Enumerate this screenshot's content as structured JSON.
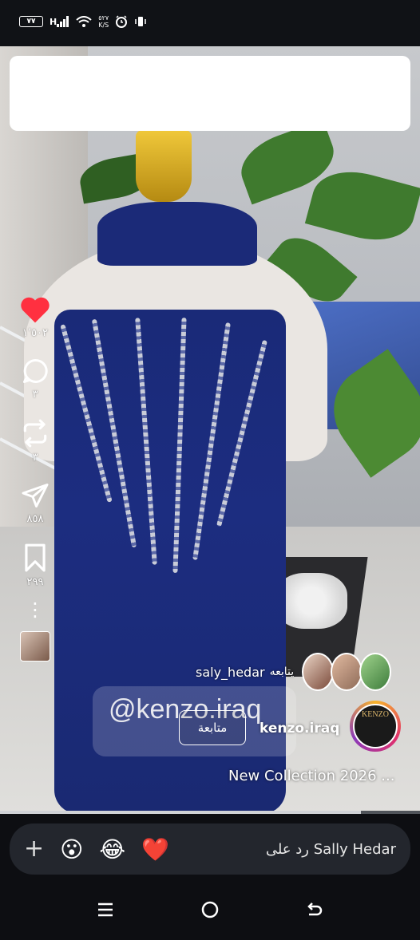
{
  "status_bar": {
    "battery_level": "٧٧",
    "network_type": "H",
    "speed_value": "٥٢٧",
    "speed_unit": "K/S"
  },
  "post": {
    "actions": [
      {
        "name": "like",
        "count": "١٬٥٠٢"
      },
      {
        "name": "comment",
        "count": "٣"
      },
      {
        "name": "repost",
        "count": "٣"
      },
      {
        "name": "share",
        "count": "٨٥٨"
      },
      {
        "name": "save",
        "count": "٢٩٩"
      }
    ],
    "followed_by_user": "saly_hedar",
    "followed_by_text": "يتابعه",
    "watermark": "@kenzo.iraq",
    "follow_button": "متابعة",
    "username": "kenzo.iraq",
    "brand_logo_text": "KENZO",
    "caption": "New Collection 2026 ...",
    "progress_fraction": 0.86
  },
  "reply_bar": {
    "emojis": [
      "😮",
      "😂",
      "❤️"
    ],
    "placeholder": "رد على Sally Hedar"
  },
  "icons": {
    "like": "heart-filled-red",
    "comment": "speech-bubble",
    "repost": "repost-arrows",
    "share": "paper-plane",
    "save": "bookmark"
  },
  "colors": {
    "like": "#ff3040",
    "dress": "#1c2d80"
  }
}
